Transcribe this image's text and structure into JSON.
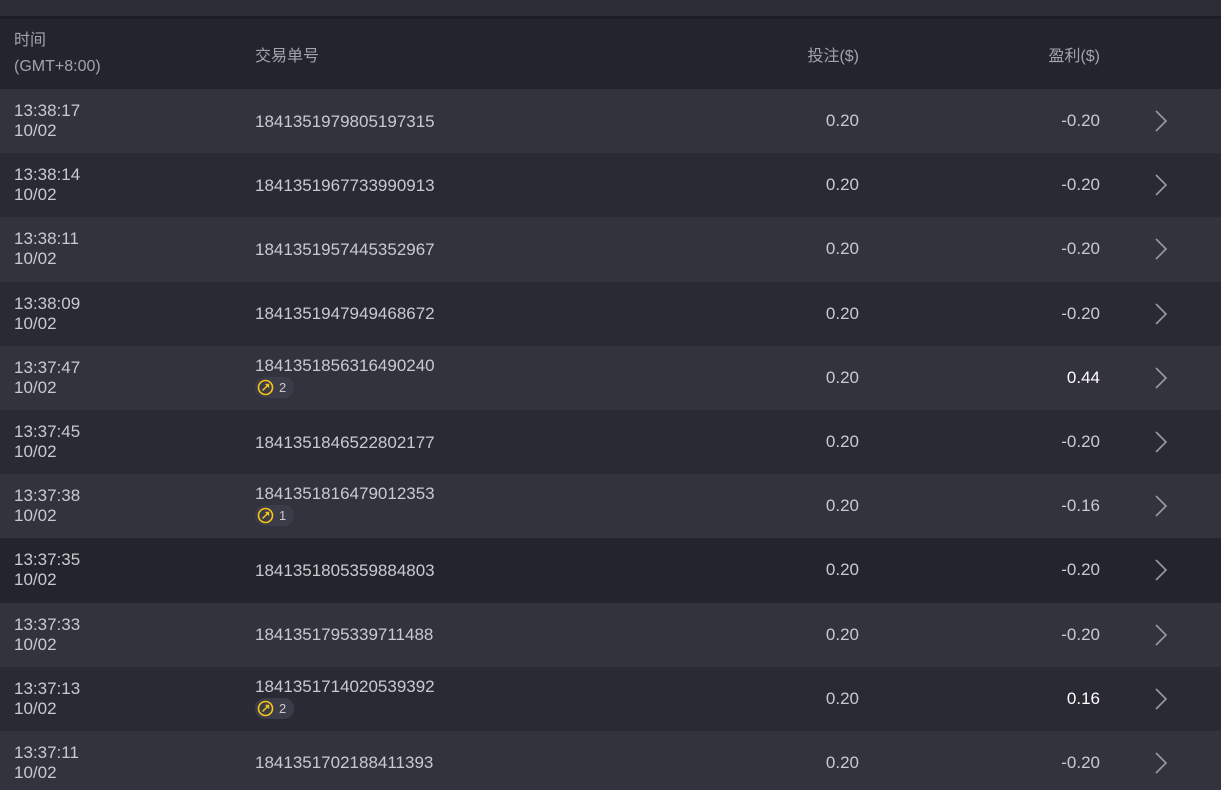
{
  "header": {
    "time_label": "时间",
    "timezone_label": "(GMT+8:00)",
    "order_label": "交易单号",
    "bet_label": "投注($)",
    "profit_label": "盈利($)"
  },
  "colors": {
    "background": "#2a2a35",
    "row_alt": "#33333e",
    "header_bg": "#24242d",
    "positive_profit": "#ffffff",
    "badge_icon": "#f5c518"
  },
  "rows": [
    {
      "time": "13:38:17",
      "date": "10/02",
      "order_id": "1841351979805197315",
      "bet": "0.20",
      "profit": "-0.20",
      "badge": null
    },
    {
      "time": "13:38:14",
      "date": "10/02",
      "order_id": "1841351967733990913",
      "bet": "0.20",
      "profit": "-0.20",
      "badge": null
    },
    {
      "time": "13:38:11",
      "date": "10/02",
      "order_id": "1841351957445352967",
      "bet": "0.20",
      "profit": "-0.20",
      "badge": null
    },
    {
      "time": "13:38:09",
      "date": "10/02",
      "order_id": "1841351947949468672",
      "bet": "0.20",
      "profit": "-0.20",
      "badge": null
    },
    {
      "time": "13:37:47",
      "date": "10/02",
      "order_id": "1841351856316490240",
      "bet": "0.20",
      "profit": "0.44",
      "badge": "2"
    },
    {
      "time": "13:37:45",
      "date": "10/02",
      "order_id": "1841351846522802177",
      "bet": "0.20",
      "profit": "-0.20",
      "badge": null
    },
    {
      "time": "13:37:38",
      "date": "10/02",
      "order_id": "1841351816479012353",
      "bet": "0.20",
      "profit": "-0.16",
      "badge": "1"
    },
    {
      "time": "13:37:35",
      "date": "10/02",
      "order_id": "1841351805359884803",
      "bet": "0.20",
      "profit": "-0.20",
      "badge": null
    },
    {
      "time": "13:37:33",
      "date": "10/02",
      "order_id": "1841351795339711488",
      "bet": "0.20",
      "profit": "-0.20",
      "badge": null
    },
    {
      "time": "13:37:13",
      "date": "10/02",
      "order_id": "1841351714020539392",
      "bet": "0.20",
      "profit": "0.16",
      "badge": "2"
    },
    {
      "time": "13:37:11",
      "date": "10/02",
      "order_id": "1841351702188411393",
      "bet": "0.20",
      "profit": "-0.20",
      "badge": null
    }
  ],
  "icons": {
    "badge_icon": "free-spin-icon",
    "row_arrow": "chevron-right-icon"
  }
}
